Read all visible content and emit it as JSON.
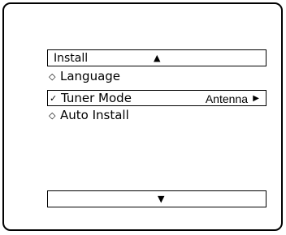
{
  "menu": {
    "title": "Install",
    "scroll_up_icon": "▲",
    "scroll_down_icon": "▼",
    "items": [
      {
        "marker": "◇",
        "label": "Language",
        "value": "",
        "arrow": ""
      },
      {
        "marker": "✓",
        "label": "Tuner Mode",
        "value": "Antenna",
        "arrow": "▶"
      },
      {
        "marker": "◇",
        "label": "Auto Install",
        "value": "",
        "arrow": ""
      }
    ],
    "selected_index": 1
  }
}
